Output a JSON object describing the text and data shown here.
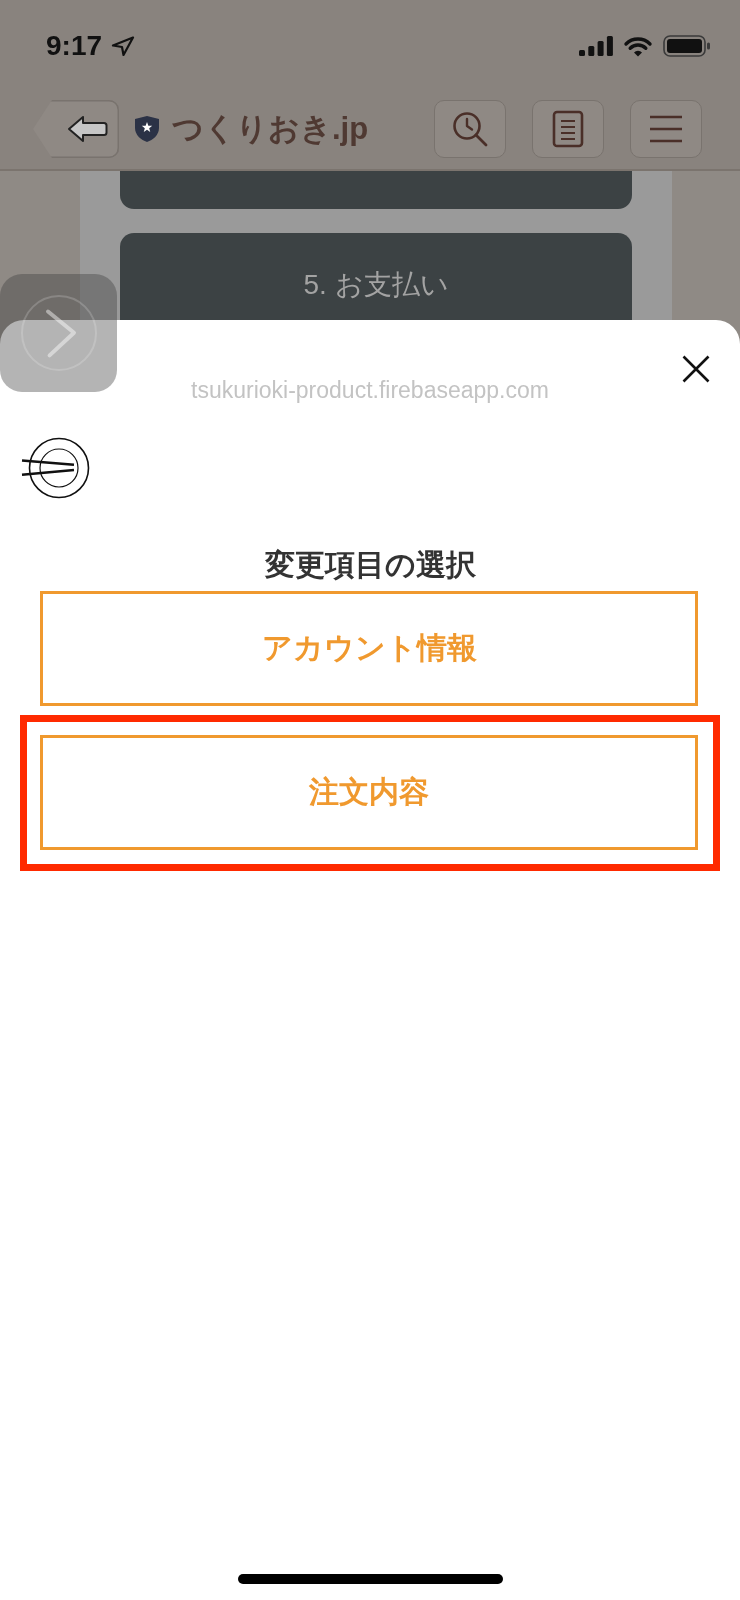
{
  "status_bar": {
    "time": "9:17"
  },
  "browser_toolbar": {
    "site_title": "つくりおき.jp"
  },
  "page_behind": {
    "step_title": "5. お支払い"
  },
  "sheet": {
    "url": "tsukurioki-product.firebaseapp.com",
    "heading": "変更項目の選択",
    "options": [
      {
        "label": "アカウント情報",
        "highlighted": false
      },
      {
        "label": "注文内容",
        "highlighted": true
      }
    ]
  }
}
